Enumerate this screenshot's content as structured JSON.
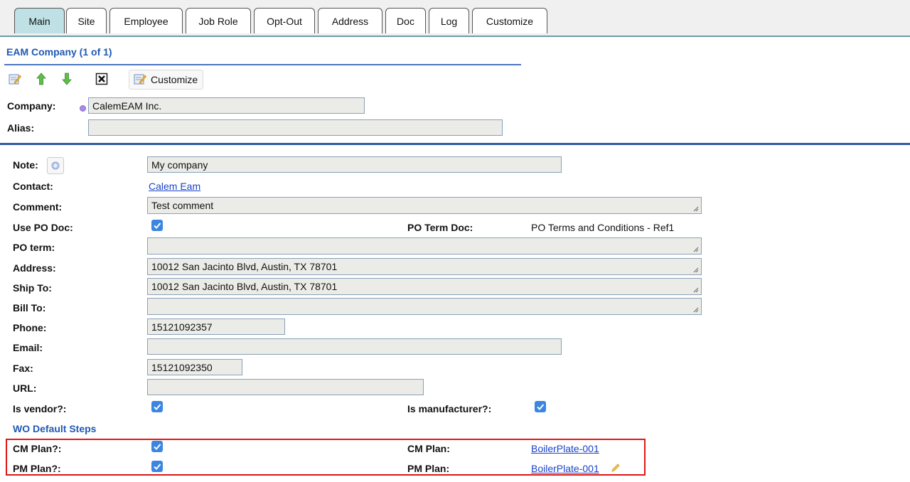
{
  "tabs": [
    "Main",
    "Site",
    "Employee",
    "Job Role",
    "Opt-Out",
    "Address",
    "Doc",
    "Log",
    "Customize"
  ],
  "active_tab": "Main",
  "section": {
    "title": "EAM Company (1 of 1)"
  },
  "toolbar": {
    "customize_label": "Customize",
    "icons": [
      "edit-icon",
      "move-up-icon",
      "move-down-icon",
      "delete-icon",
      "customize-icon"
    ]
  },
  "header_form": {
    "company_label": "Company:",
    "company_value": "CalemEAM Inc.",
    "alias_label": "Alias:",
    "alias_value": ""
  },
  "form": {
    "note_label": "Note:",
    "note_value": "My company",
    "contact_label": "Contact:",
    "contact_value": "Calem Eam",
    "comment_label": "Comment:",
    "comment_value": "Test comment",
    "use_po_doc_label": "Use PO Doc:",
    "use_po_doc_checked": true,
    "po_term_doc_label": "PO Term Doc:",
    "po_term_doc_value": "PO Terms and Conditions - Ref1",
    "po_term_label": "PO term:",
    "po_term_value": "",
    "address_label": "Address:",
    "address_value": "10012 San Jacinto Blvd, Austin, TX 78701",
    "ship_to_label": "Ship To:",
    "ship_to_value": "10012 San Jacinto Blvd, Austin, TX 78701",
    "bill_to_label": "Bill To:",
    "bill_to_value": "",
    "phone_label": "Phone:",
    "phone_value": "15121092357",
    "email_label": "Email:",
    "email_value": "",
    "fax_label": "Fax:",
    "fax_value": "15121092350",
    "url_label": "URL:",
    "url_value": "",
    "is_vendor_label": "Is vendor?:",
    "is_vendor_checked": true,
    "is_manufacturer_label": "Is manufacturer?:",
    "is_manufacturer_checked": true,
    "wo_default_steps_label": "WO Default Steps",
    "cm_plan_flag_label": "CM Plan?:",
    "cm_plan_flag_checked": true,
    "cm_plan_label": "CM Plan:",
    "cm_plan_value": "BoilerPlate-001",
    "pm_plan_flag_label": "PM Plan?:",
    "pm_plan_flag_checked": true,
    "pm_plan_label": "PM Plan:",
    "pm_plan_value": "BoilerPlate-001"
  },
  "colors": {
    "accent": "#1f59b4",
    "checkbox": "#3b86e0",
    "highlight": "#e01515",
    "field_bg": "#ebebe7",
    "active_tab": "#bfe0e4"
  }
}
